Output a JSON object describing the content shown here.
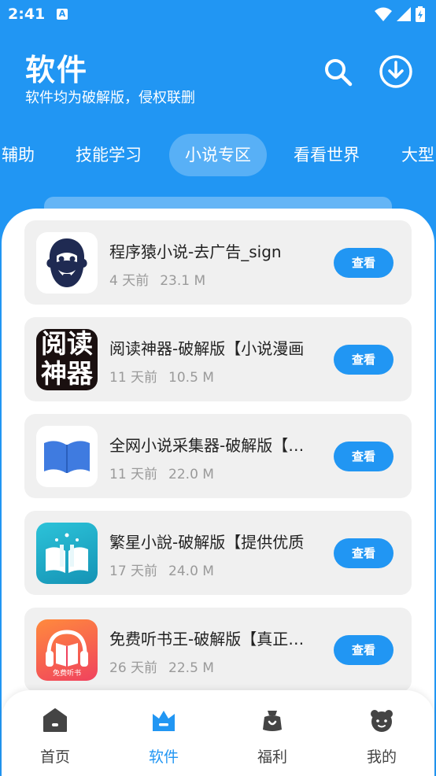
{
  "status": {
    "time": "2:41",
    "notif_letter": "A"
  },
  "header": {
    "title": "软件",
    "subtitle": "软件均为破解版，侵权联删"
  },
  "tabs": [
    {
      "label": "辅助"
    },
    {
      "label": "技能学习"
    },
    {
      "label": "小说专区"
    },
    {
      "label": "看看世界"
    },
    {
      "label": "大型"
    }
  ],
  "active_tab": "小说专区",
  "items": [
    {
      "name": "程序猿小说-去广告_sign",
      "age": "4 天前",
      "size": "23.1 M",
      "button": "查看",
      "icon": "monkey-logo-icon"
    },
    {
      "name": "阅读神器-破解版【小说漫画",
      "age": "11 天前",
      "size": "10.5 M",
      "button": "查看",
      "icon": "reading-artifact-icon",
      "icon_text": [
        "阅读",
        "神器"
      ]
    },
    {
      "name": "全网小说采集器-破解版【畅读",
      "age": "11 天前",
      "size": "22.0 M",
      "button": "查看",
      "icon": "open-book-icon"
    },
    {
      "name": "繁星小說-破解版【提供优质",
      "age": "17 天前",
      "size": "24.0 M",
      "button": "查看",
      "icon": "star-book-icon"
    },
    {
      "name": "免费听书王-破解版【真正免费",
      "age": "26 天前",
      "size": "22.5 M",
      "button": "查看",
      "icon": "audiobook-icon",
      "icon_text": [
        "免费听书"
      ]
    }
  ],
  "nav": [
    {
      "label": "首页",
      "icon": "home-icon"
    },
    {
      "label": "软件",
      "icon": "software-icon"
    },
    {
      "label": "福利",
      "icon": "gift-bag-icon"
    },
    {
      "label": "我的",
      "icon": "profile-icon"
    }
  ],
  "active_nav": "软件",
  "colors": {
    "primary": "#2196f3",
    "card": "#f0f0f0",
    "muted": "#9a9a9a"
  }
}
